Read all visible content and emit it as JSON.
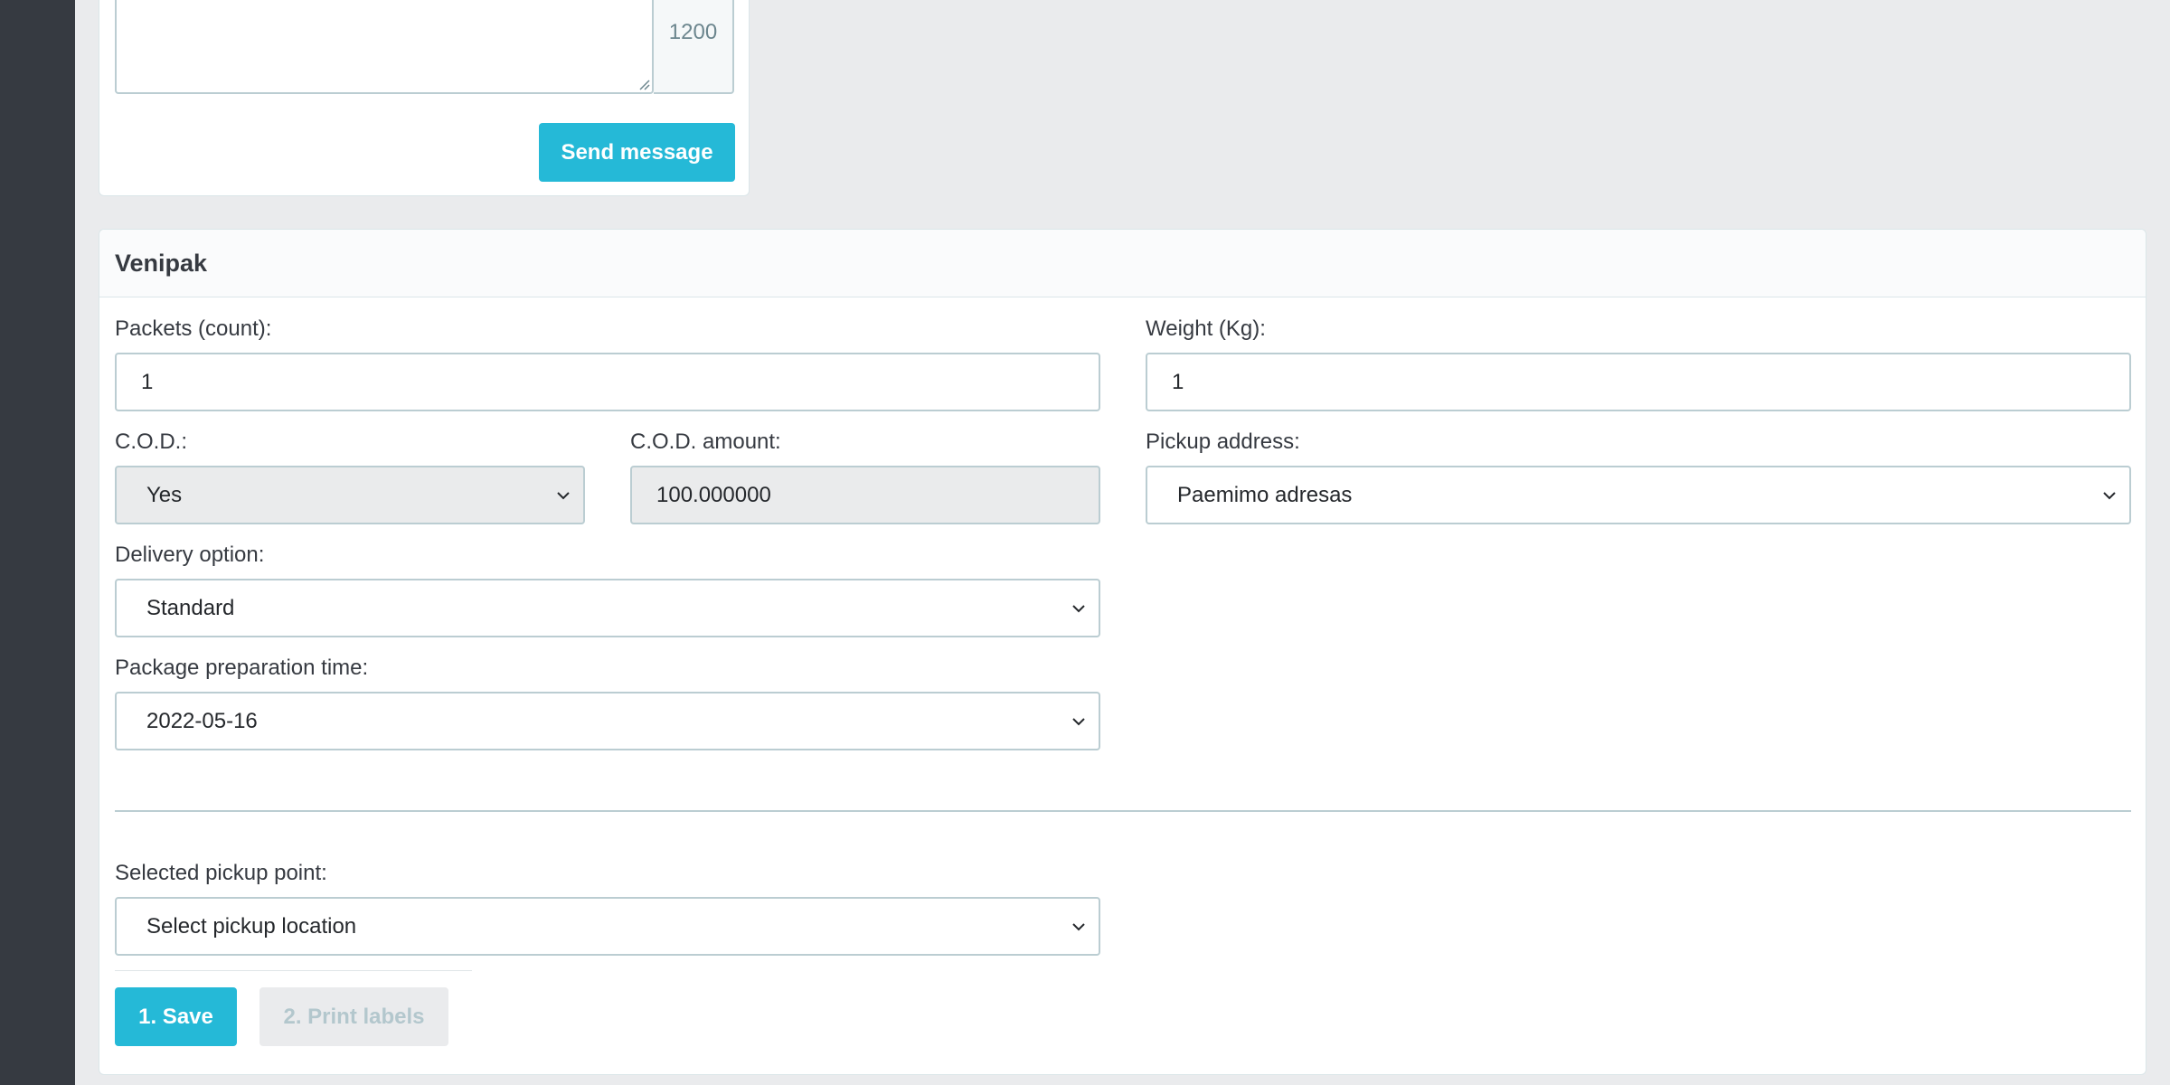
{
  "message": {
    "char_count": "1200",
    "send_label": "Send message"
  },
  "venipak": {
    "title": "Venipak",
    "packets_label": "Packets (count):",
    "packets_value": "1",
    "weight_label": "Weight (Kg):",
    "weight_value": "1",
    "cod_label": "C.O.D.:",
    "cod_value": "Yes",
    "cod_amount_label": "C.O.D. amount:",
    "cod_amount_value": "100.000000",
    "pickup_address_label": "Pickup address:",
    "pickup_address_value": "Paemimo adresas",
    "delivery_option_label": "Delivery option:",
    "delivery_option_value": "Standard",
    "prep_time_label": "Package preparation time:",
    "prep_time_value": "2022-05-16",
    "pickup_point_label": "Selected pickup point:",
    "pickup_point_value": "Select pickup location",
    "save_label": "1. Save",
    "print_label": "2. Print labels"
  },
  "colors": {
    "accent": "#25b9d7",
    "sidebar": "#363a41",
    "background": "#eaebed",
    "field_border": "#bbcdd2"
  },
  "icons": {
    "select_arrow": "chevron-down-icon",
    "textarea_resize": "resize-handle-icon"
  }
}
